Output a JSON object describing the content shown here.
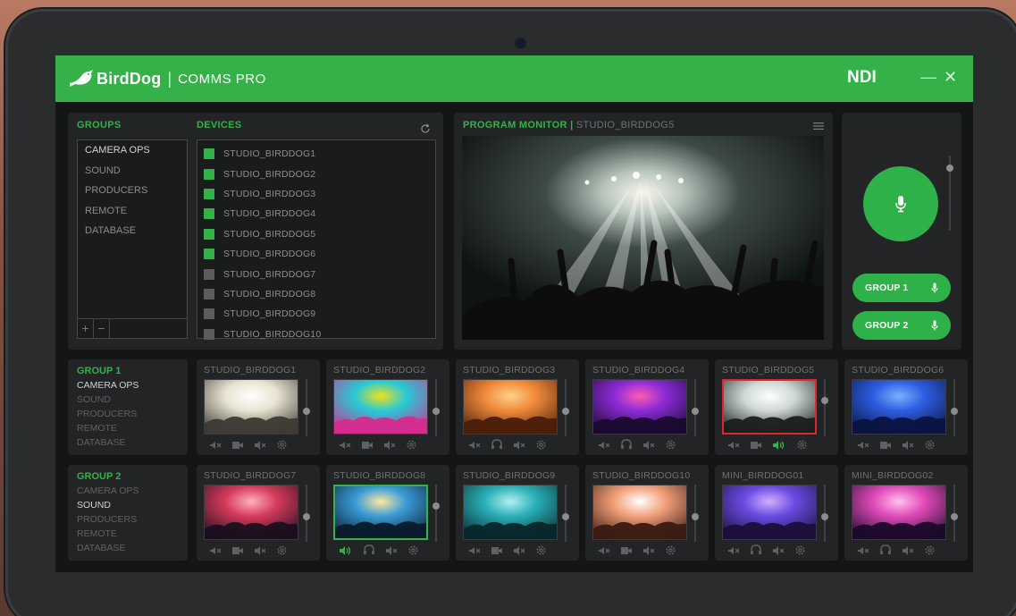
{
  "app": {
    "brand": "BirdDog",
    "separator": "|",
    "product": "COMMS PRO",
    "ndi": "NDI",
    "minimize": "—",
    "close": "✕"
  },
  "groups_panel": {
    "header": "GROUPS",
    "items": [
      "CAMERA OPS",
      "SOUND",
      "PRODUCERS",
      "REMOTE",
      "DATABASE"
    ],
    "selected": "CAMERA OPS",
    "add": "+",
    "remove": "−"
  },
  "devices_panel": {
    "header": "DEVICES",
    "devices": [
      {
        "name": "STUDIO_BIRDDOG1",
        "active": true
      },
      {
        "name": "STUDIO_BIRDDOG2",
        "active": true
      },
      {
        "name": "STUDIO_BIRDDOG3",
        "active": true
      },
      {
        "name": "STUDIO_BIRDDOG4",
        "active": true
      },
      {
        "name": "STUDIO_BIRDDOG5",
        "active": true
      },
      {
        "name": "STUDIO_BIRDDOG6",
        "active": true
      },
      {
        "name": "STUDIO_BIRDDOG7",
        "active": false
      },
      {
        "name": "STUDIO_BIRDDOG8",
        "active": false
      },
      {
        "name": "STUDIO_BIRDDOG9",
        "active": false
      },
      {
        "name": "STUDIO_BIRDDOG10",
        "active": false
      }
    ]
  },
  "program_monitor": {
    "label": "PROGRAM MONITOR",
    "separator": "|",
    "source": "STUDIO_BIRDDOG5"
  },
  "talk_panel": {
    "group_buttons": [
      "GROUP 1",
      "GROUP 2"
    ]
  },
  "group_rows": [
    {
      "title": "GROUP 1",
      "items": [
        "CAMERA OPS",
        "SOUND",
        "PRODUCERS",
        "REMOTE",
        "DATABASE"
      ],
      "active_item": "CAMERA OPS",
      "tiles": [
        {
          "name": "STUDIO_BIRDDOG1",
          "scene": "stage",
          "highlight": "none",
          "mode": "camera",
          "talk": false
        },
        {
          "name": "STUDIO_BIRDDOG2",
          "scene": "colorful",
          "highlight": "none",
          "mode": "camera",
          "talk": false
        },
        {
          "name": "STUDIO_BIRDDOG3",
          "scene": "orange",
          "highlight": "none",
          "mode": "headset",
          "talk": false
        },
        {
          "name": "STUDIO_BIRDDOG4",
          "scene": "purple",
          "highlight": "none",
          "mode": "headset",
          "talk": false
        },
        {
          "name": "STUDIO_BIRDDOG5",
          "scene": "crowd",
          "highlight": "red",
          "mode": "camera",
          "talk": true
        },
        {
          "name": "STUDIO_BIRDDOG6",
          "scene": "blue",
          "highlight": "none",
          "mode": "camera",
          "talk": false
        }
      ]
    },
    {
      "title": "GROUP 2",
      "items": [
        "CAMERA OPS",
        "SOUND",
        "PRODUCERS",
        "REMOTE",
        "DATABASE"
      ],
      "active_item": "SOUND",
      "tiles": [
        {
          "name": "STUDIO_BIRDDOG7",
          "scene": "band",
          "highlight": "none",
          "mode": "camera",
          "talk": false
        },
        {
          "name": "STUDIO_BIRDDOG8",
          "scene": "guitar",
          "highlight": "green",
          "mode": "headset",
          "talk": true
        },
        {
          "name": "STUDIO_BIRDDOG9",
          "scene": "teal",
          "highlight": "none",
          "mode": "camera",
          "talk": false
        },
        {
          "name": "STUDIO_BIRDDOG10",
          "scene": "dancer",
          "highlight": "none",
          "mode": "camera",
          "talk": false
        },
        {
          "name": "MINI_BIRDDOG01",
          "scene": "violet",
          "highlight": "none",
          "mode": "headset",
          "talk": false
        },
        {
          "name": "MINI_BIRDDOG02",
          "scene": "pink",
          "highlight": "none",
          "mode": "headset",
          "talk": false
        }
      ]
    }
  ],
  "colors": {
    "accent": "#34b249",
    "live": "#e0262b",
    "panel": "#232425",
    "text_muted": "#6e7173"
  }
}
